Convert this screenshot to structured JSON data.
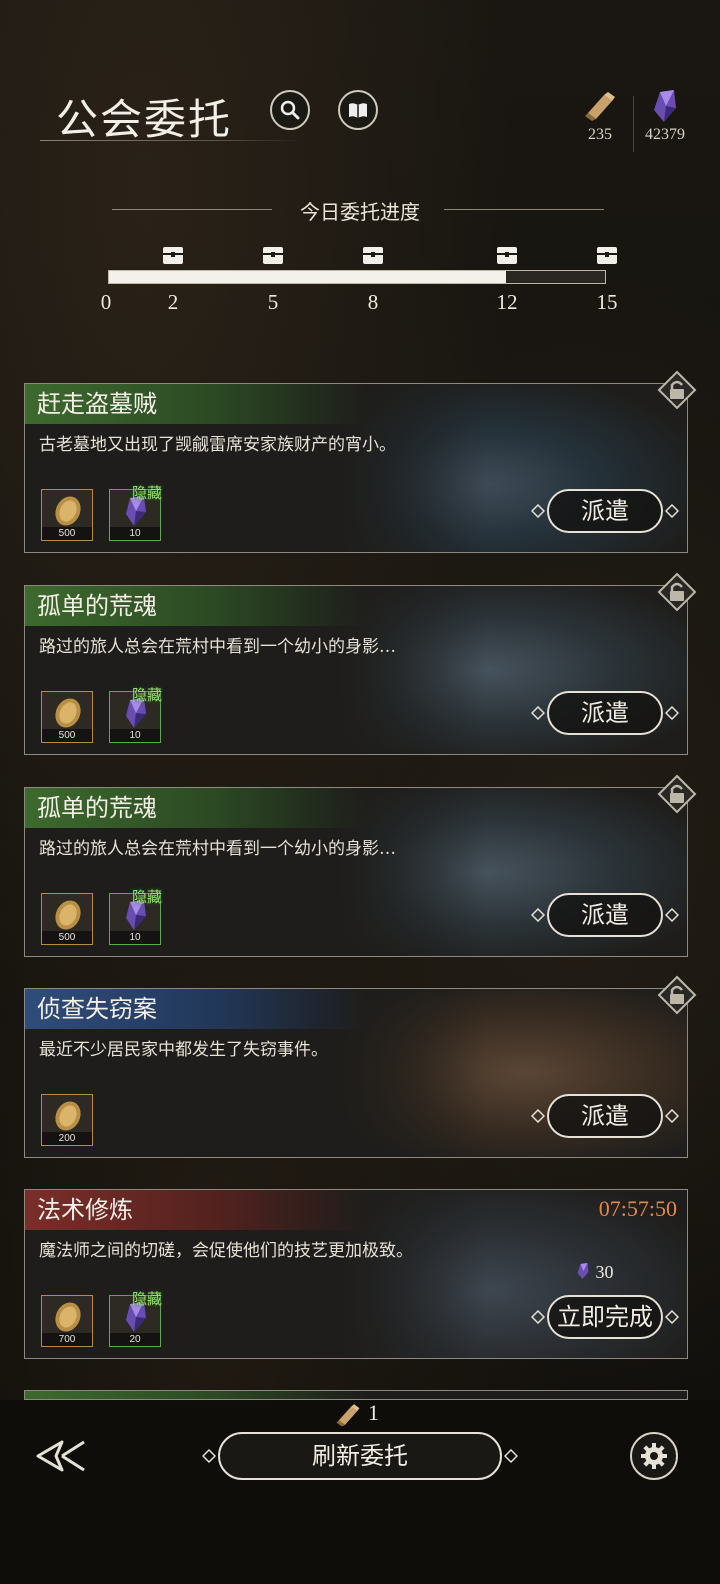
{
  "header": {
    "title": "公会委托",
    "resources": [
      {
        "icon": "scroll-icon",
        "value": "235"
      },
      {
        "icon": "crystal-icon",
        "value": "42379"
      }
    ]
  },
  "progress": {
    "title": "今日委托进度",
    "current_fraction": 0.8,
    "ticks": [
      "0",
      "2",
      "5",
      "8",
      "12",
      "15"
    ],
    "milestones": [
      2,
      5,
      8,
      12,
      15
    ],
    "max": 15
  },
  "quests": [
    {
      "title": "赶走盗墓贼",
      "color": "green",
      "desc": "古老墓地又出现了觊觎雷席安家族财产的宵小。",
      "rewards": [
        {
          "icon": "gold-coin-icon",
          "amount": "500",
          "hidden": false
        },
        {
          "icon": "crystal-icon",
          "amount": "10",
          "hidden": true,
          "tag": "隐藏"
        }
      ],
      "button": "派遣"
    },
    {
      "title": "孤单的荒魂",
      "color": "green",
      "desc": "路过的旅人总会在荒村中看到一个幼小的身影…",
      "rewards": [
        {
          "icon": "gold-coin-icon",
          "amount": "500",
          "hidden": false
        },
        {
          "icon": "crystal-icon",
          "amount": "10",
          "hidden": true,
          "tag": "隐藏"
        }
      ],
      "button": "派遣"
    },
    {
      "title": "孤单的荒魂",
      "color": "green",
      "desc": "路过的旅人总会在荒村中看到一个幼小的身影…",
      "rewards": [
        {
          "icon": "gold-coin-icon",
          "amount": "500",
          "hidden": false
        },
        {
          "icon": "crystal-icon",
          "amount": "10",
          "hidden": true,
          "tag": "隐藏"
        }
      ],
      "button": "派遣"
    },
    {
      "title": "侦查失窃案",
      "color": "blue",
      "desc": "最近不少居民家中都发生了失窃事件。",
      "rewards": [
        {
          "icon": "gold-coin-icon",
          "amount": "200",
          "hidden": false
        }
      ],
      "button": "派遣"
    },
    {
      "title": "法术修炼",
      "color": "red",
      "desc": "魔法师之间的切磋，会促使他们的技艺更加极致。",
      "timer": "07:57:50",
      "cost": "30",
      "rewards": [
        {
          "icon": "gold-coin-icon",
          "amount": "700",
          "hidden": false
        },
        {
          "icon": "crystal-icon",
          "amount": "20",
          "hidden": true,
          "tag": "隐藏"
        }
      ],
      "button": "立即完成"
    }
  ],
  "bottom": {
    "refresh_count": "1",
    "refresh_label": "刷新委托"
  },
  "colors": {
    "accent_timer": "#e6874b",
    "hidden_tag": "#8fe36a",
    "bar_fill": "#f4f1ea"
  }
}
